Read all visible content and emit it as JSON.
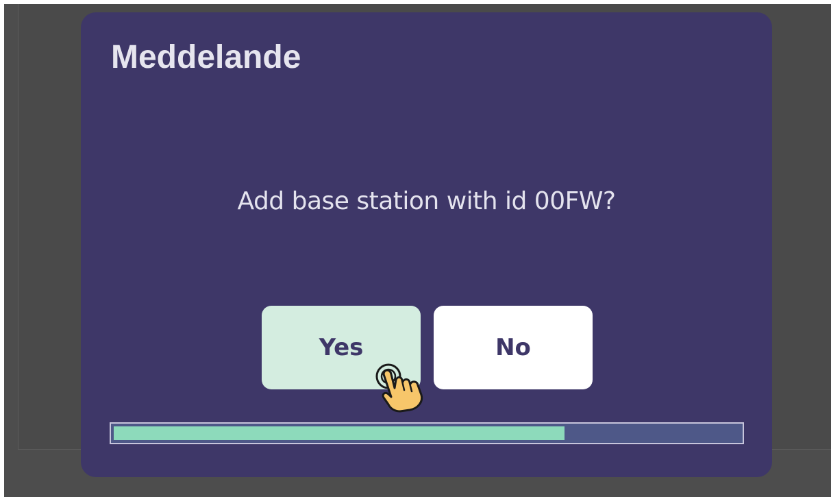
{
  "dialog": {
    "title": "Meddelande",
    "message": "Add base station with id 00FW?",
    "yes_label": "Yes",
    "no_label": "No",
    "progress_fraction": 0.72
  },
  "cursor": {
    "icon": "hand-pointer-icon"
  },
  "colors": {
    "dialog_background": "#3e3768",
    "yes_button": "#d4ede0",
    "no_button": "#ffffff",
    "progress_fill": "#8ddabb",
    "progress_track": "#4e5888"
  }
}
